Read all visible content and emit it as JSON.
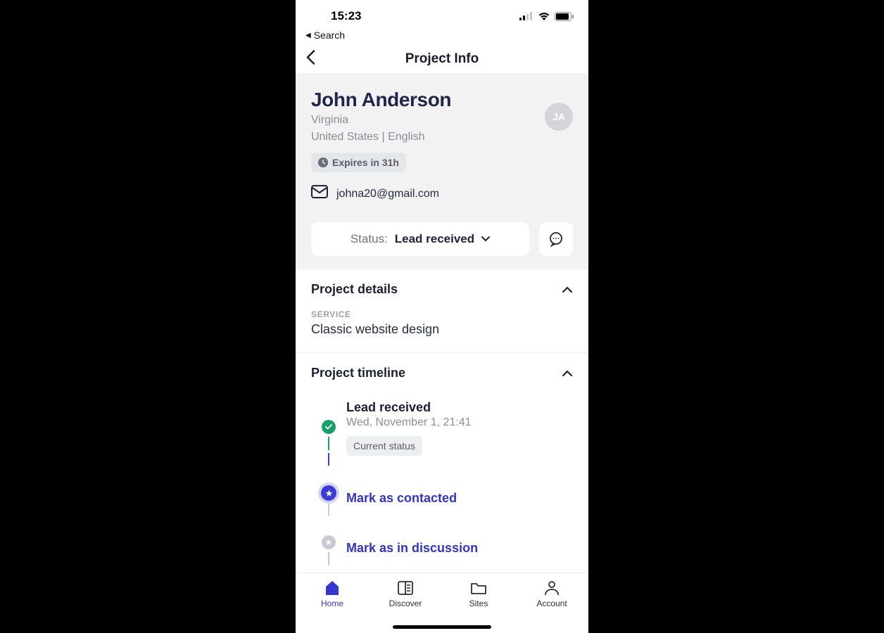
{
  "status_bar": {
    "time": "15:23"
  },
  "back_link": "Search",
  "nav": {
    "title": "Project Info"
  },
  "contact": {
    "name": "John Anderson",
    "region": "Virginia",
    "locale_line": "United States | English",
    "avatar_initials": "JA",
    "expires_label": "Expires in 31h",
    "email": "johna20@gmail.com"
  },
  "status": {
    "prefix": "Status:",
    "value": "Lead received"
  },
  "details": {
    "section_title": "Project details",
    "service_label": "SERVICE",
    "service_value": "Classic website design"
  },
  "timeline": {
    "section_title": "Project timeline",
    "items": [
      {
        "title": "Lead received",
        "sub": "Wed, November 1, 21:41",
        "badge": "Current status"
      },
      {
        "action": "Mark as contacted"
      },
      {
        "action": "Mark as in discussion"
      }
    ]
  },
  "tabs": {
    "home": "Home",
    "discover": "Discover",
    "sites": "Sites",
    "account": "Account"
  }
}
